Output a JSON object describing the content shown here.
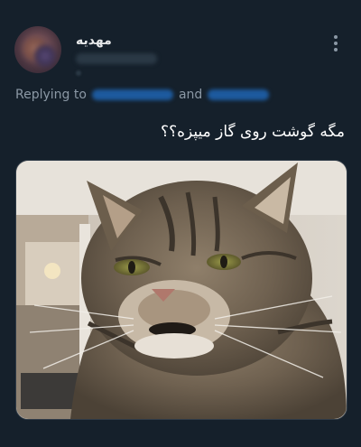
{
  "tweet": {
    "author_name": "مهدیه",
    "reply_prefix": "Replying to",
    "reply_and": "and",
    "text": "مگه گوشت روی گاز میپزه؟؟",
    "media_icon": "cat-photo"
  },
  "icons": {
    "more": "more-vertical-icon",
    "avatar": "profile-avatar"
  },
  "colors": {
    "background": "#15202b",
    "text_primary": "#e7e9ea",
    "text_secondary": "#8b98a5",
    "link": "#1d9bf0"
  }
}
